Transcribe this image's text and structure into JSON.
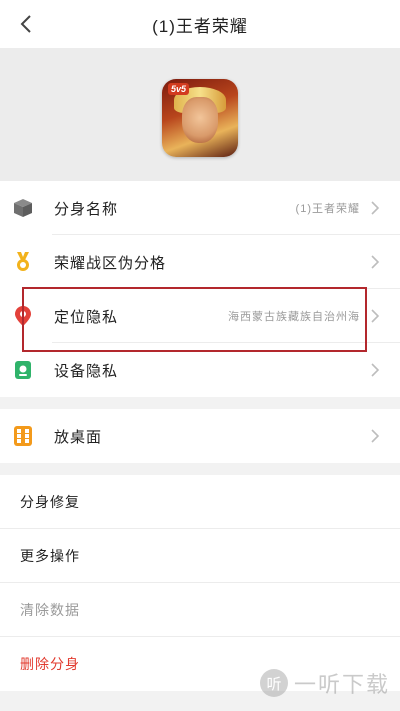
{
  "header": {
    "title": "(1)王者荣耀"
  },
  "app": {
    "badge": "5v5"
  },
  "settings": [
    {
      "label": "分身名称",
      "value": "(1)王者荣耀",
      "icon": "cube-icon"
    },
    {
      "label": "荣耀战区伪分格",
      "value": "",
      "icon": "medal-icon"
    },
    {
      "label": "定位隐私",
      "value": "海西蒙古族藏族自治州海",
      "icon": "location-pin-icon"
    },
    {
      "label": "设备隐私",
      "value": "",
      "icon": "device-icon"
    }
  ],
  "desktop": {
    "label": "放桌面",
    "icon": "grid-icon"
  },
  "actions": [
    {
      "label": "分身修复",
      "color": "#222222"
    },
    {
      "label": "更多操作",
      "color": "#222222"
    },
    {
      "label": "清除数据",
      "color": "#9a9a9a"
    },
    {
      "label": "删除分身",
      "color": "#e23b2f"
    }
  ],
  "watermark": {
    "logo": "听",
    "text": "一听下载"
  },
  "colors": {
    "highlight": "#b3282d",
    "danger": "#e23b2f",
    "pin": "#e3413a",
    "device": "#2fb36a",
    "medal": "#f2b21c",
    "grid": "#f39a1b"
  }
}
